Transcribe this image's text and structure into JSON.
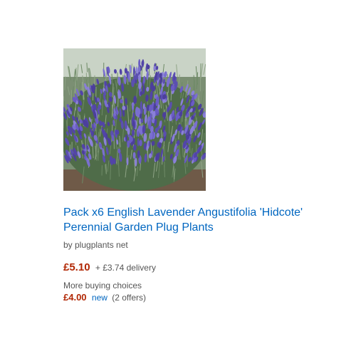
{
  "product": {
    "image_icon": "lavender-plant-photo",
    "title": "Pack x6 English Lavender Angustifolia 'Hidcote' Perennial Garden Plug Plants",
    "byline": "by plugplants net",
    "price": "£5.10",
    "delivery": "+ £3.74 delivery",
    "more_buying_label": "More buying choices",
    "offer_price": "£4.00",
    "offer_condition": "new",
    "offer_count": "(2 offers)"
  },
  "colors": {
    "link": "#0066c0",
    "price": "#b12704",
    "muted": "#555555"
  }
}
